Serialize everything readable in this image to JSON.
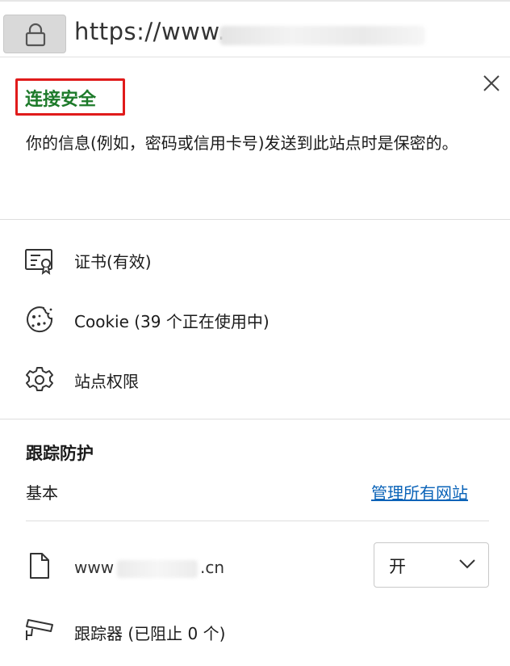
{
  "address_bar": {
    "url_prefix": "https://www."
  },
  "security": {
    "title": "连接安全",
    "description": "你的信息(例如，密码或信用卡号)发送到此站点时是保密的。",
    "title_color": "#1d7a2a",
    "highlight_color": "#e01b1b"
  },
  "items": [
    {
      "icon": "certificate-icon",
      "label": "证书(有效)"
    },
    {
      "icon": "cookie-icon",
      "label": "Cookie (39 个正在使用中)"
    },
    {
      "icon": "gear-icon",
      "label": "站点权限"
    }
  ],
  "tracking": {
    "title": "跟踪防护",
    "level": "基本",
    "manage_link": "管理所有网站",
    "link_color": "#0a63b8",
    "site_prefix": "www",
    "site_suffix": ".cn",
    "toggle_value": "开",
    "trackers_label": "跟踪器 (已阻止 0 个)"
  }
}
